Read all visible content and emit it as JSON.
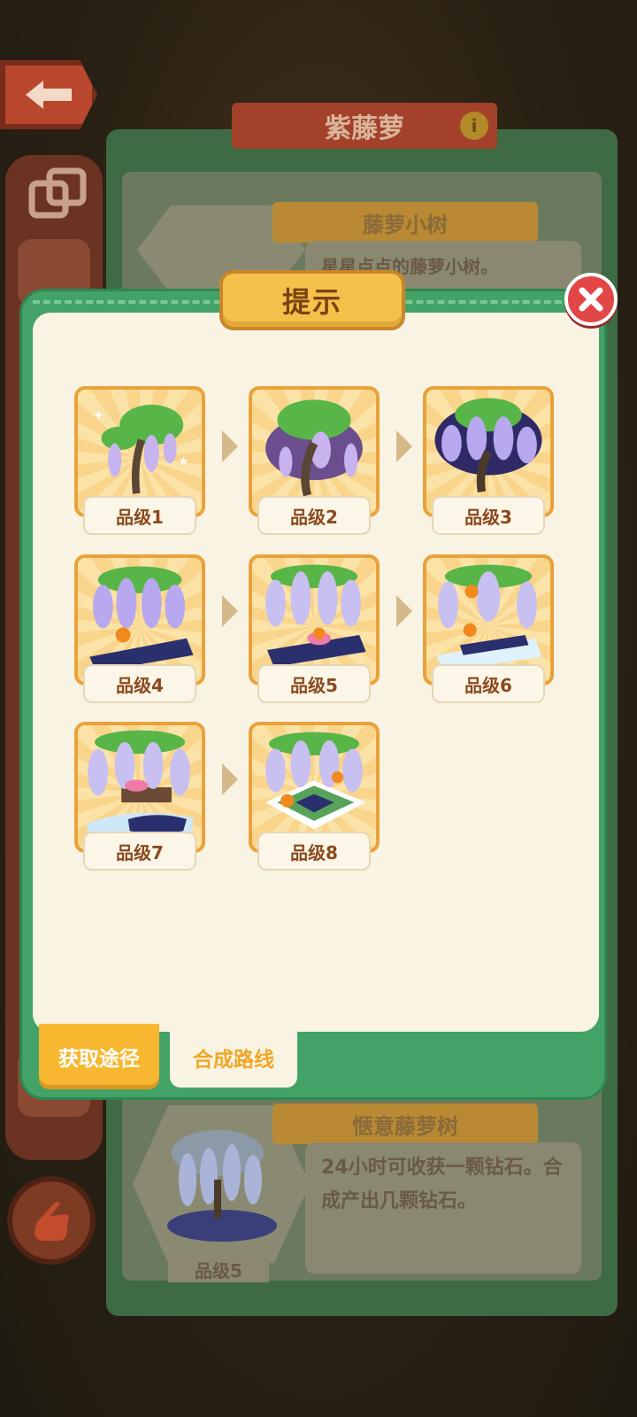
{
  "background": {
    "title": "紫藤萝",
    "card_top": {
      "name": "藤萝小树",
      "desc": "星星点点的藤萝小树。"
    },
    "card_bottom": {
      "name": "惬意藤萝树",
      "desc": "24小时可收获一颗钻石。合成产出几颗钻石。",
      "grade": "品级5"
    }
  },
  "dialog": {
    "title": "提示",
    "tiles": [
      {
        "label": "品级1"
      },
      {
        "label": "品级2"
      },
      {
        "label": "品级3"
      },
      {
        "label": "品级4"
      },
      {
        "label": "品级5"
      },
      {
        "label": "品级6"
      },
      {
        "label": "品级7"
      },
      {
        "label": "品级8"
      }
    ],
    "tabs": {
      "source": "获取途径",
      "route": "合成路线"
    }
  },
  "colors": {
    "accent_green": "#43a367",
    "accent_orange": "#f7b731",
    "close_red": "#e24646"
  }
}
